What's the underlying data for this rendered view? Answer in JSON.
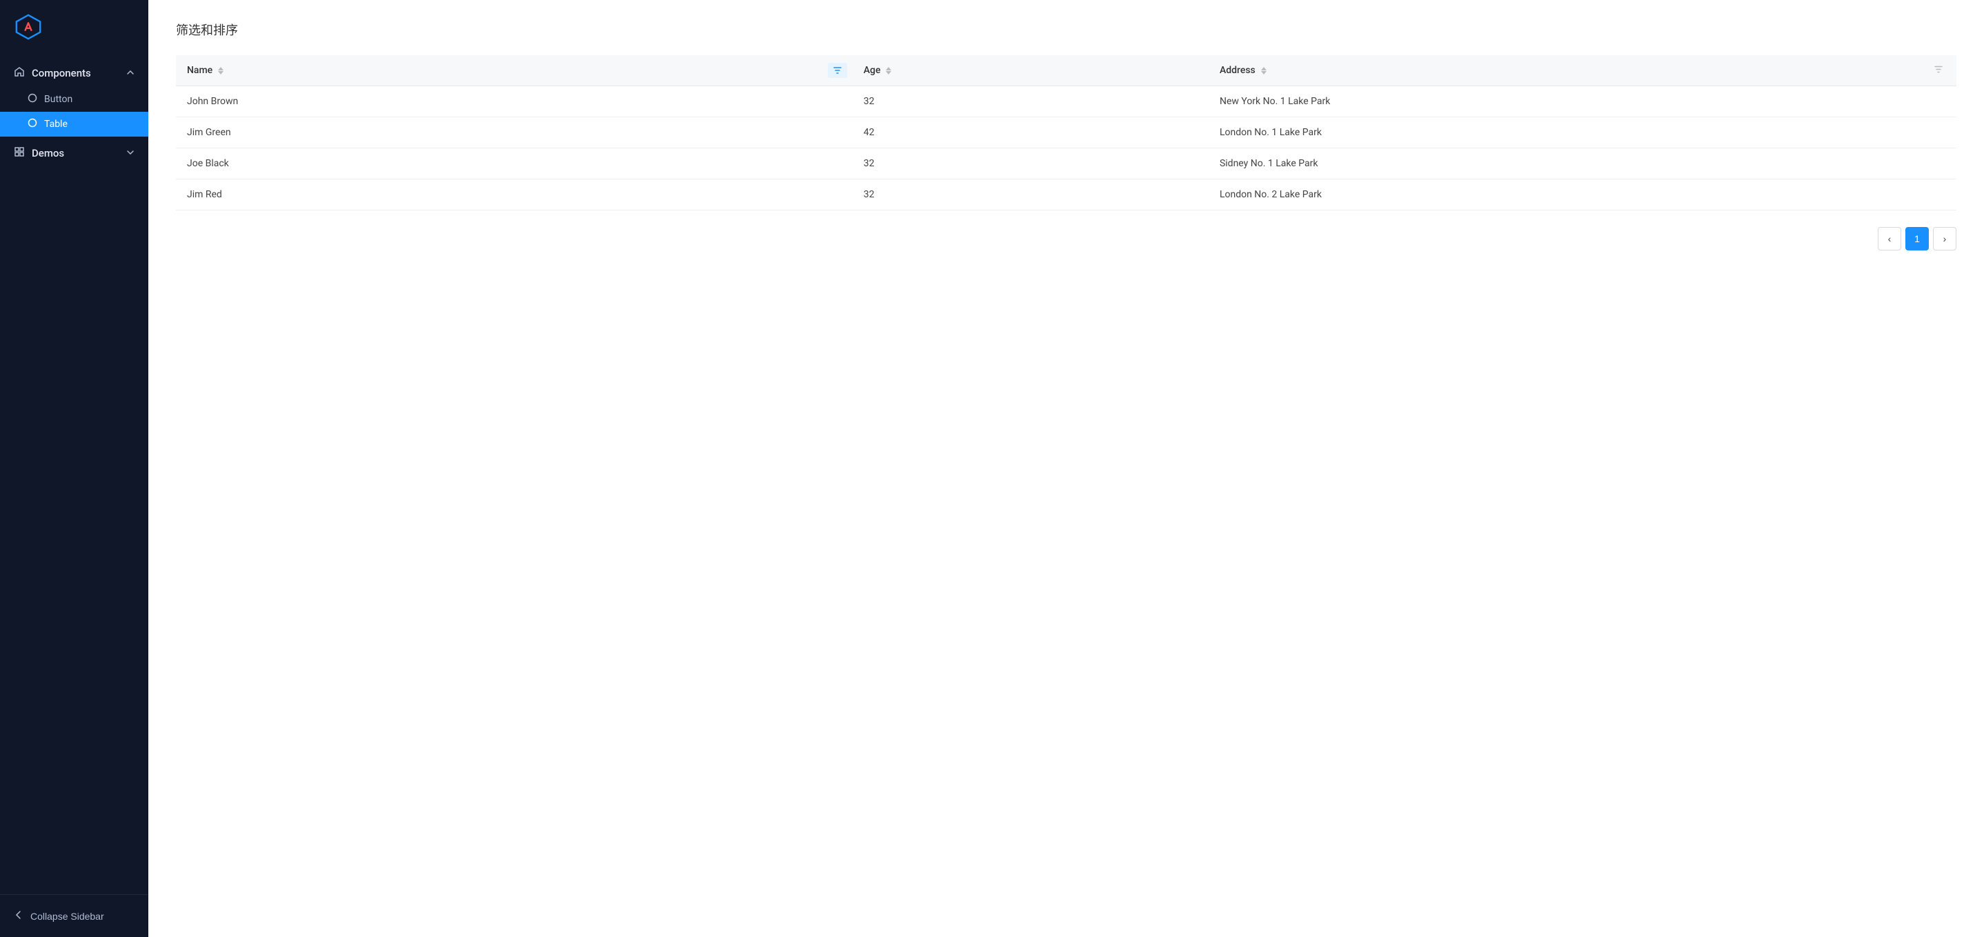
{
  "sidebar": {
    "logo_alt": "Logo",
    "groups": [
      {
        "label": "Components",
        "icon": "home-icon",
        "expanded": true,
        "items": [
          {
            "label": "Button",
            "icon": "tag-icon",
            "active": false
          },
          {
            "label": "Table",
            "icon": "tag-icon",
            "active": true
          }
        ]
      },
      {
        "label": "Demos",
        "icon": "grid-icon",
        "expanded": false,
        "items": []
      }
    ],
    "collapse_label": "Collapse Sidebar"
  },
  "main": {
    "section_title": "筛选和排序",
    "table": {
      "columns": [
        {
          "key": "name",
          "label": "Name",
          "has_sort": true,
          "has_filter_active": true
        },
        {
          "key": "age",
          "label": "Age",
          "has_sort": true,
          "has_filter_active": false
        },
        {
          "key": "address",
          "label": "Address",
          "has_sort": true,
          "has_filter_active": false
        }
      ],
      "rows": [
        {
          "name": "John Brown",
          "age": "32",
          "address": "New York No. 1 Lake Park"
        },
        {
          "name": "Jim Green",
          "age": "42",
          "address": "London No. 1 Lake Park"
        },
        {
          "name": "Joe Black",
          "age": "32",
          "address": "Sidney No. 1 Lake Park"
        },
        {
          "name": "Jim Red",
          "age": "32",
          "address": "London No. 2 Lake Park"
        }
      ]
    },
    "pagination": {
      "prev_label": "‹",
      "next_label": "›",
      "current_page": "1"
    }
  }
}
